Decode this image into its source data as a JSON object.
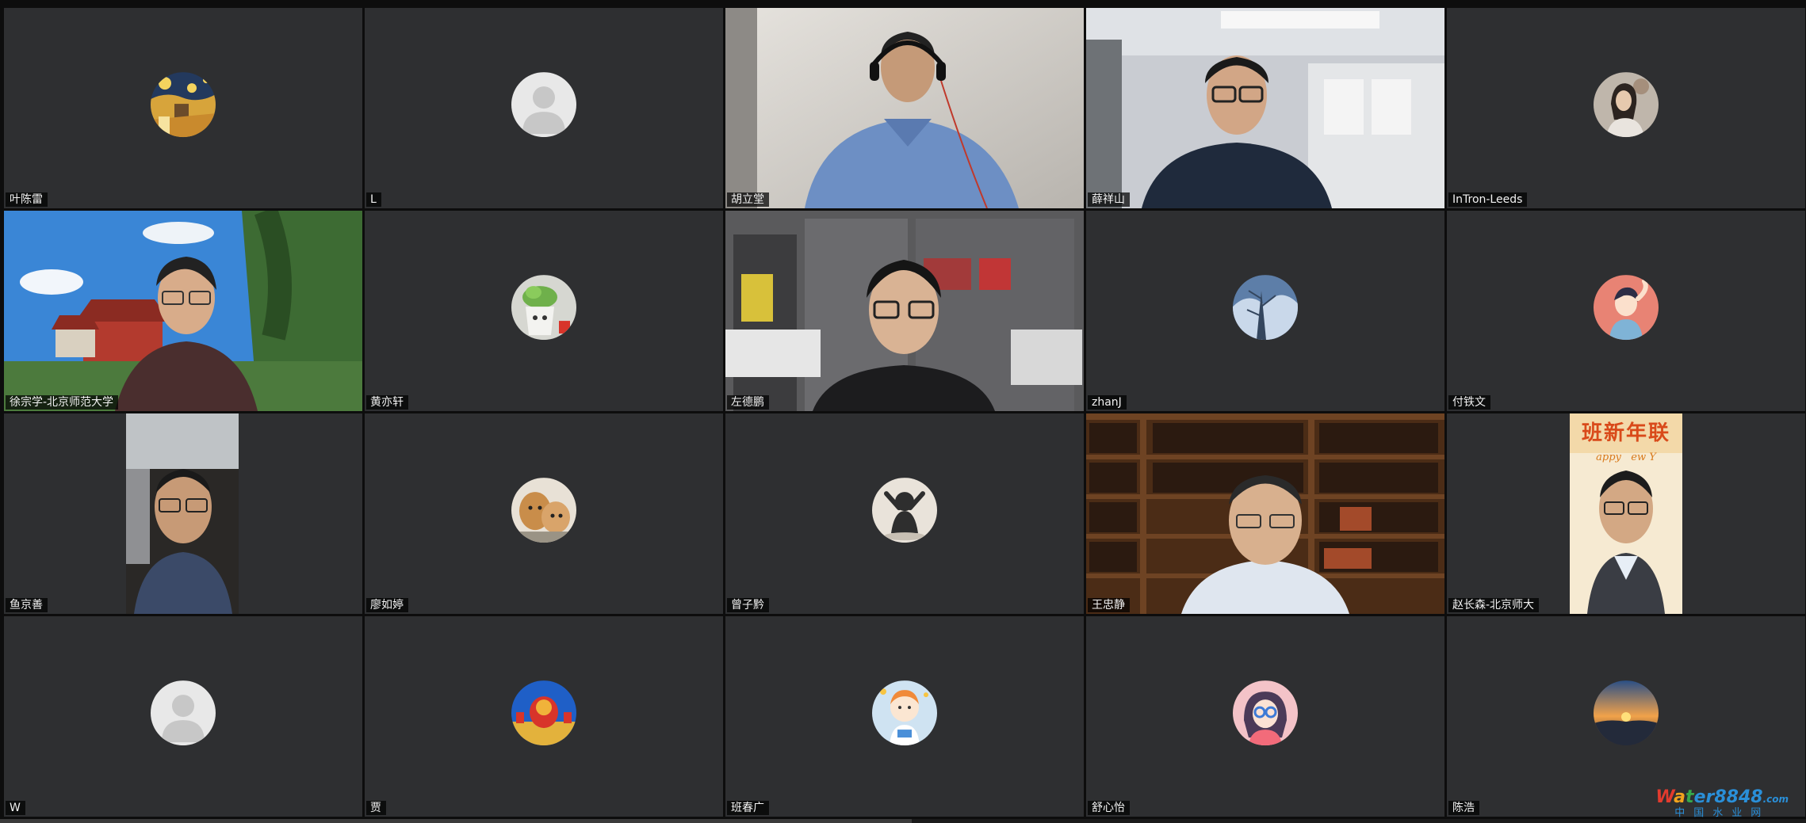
{
  "participants": [
    {
      "name": "叶陈雷",
      "type": "avatar",
      "avatar": "night-painting-avatar-icon"
    },
    {
      "name": "L",
      "type": "avatar",
      "avatar": "default-user-avatar-icon"
    },
    {
      "name": "胡立堂",
      "type": "video"
    },
    {
      "name": "薛祥山",
      "type": "video"
    },
    {
      "name": "InTron-Leeds",
      "type": "avatar",
      "avatar": "portrait-photo-avatar-icon"
    },
    {
      "name": "徐宗学-北京师范大学",
      "type": "video",
      "active_speaker": true
    },
    {
      "name": "黄亦轩",
      "type": "avatar",
      "avatar": "plant-pot-avatar-icon"
    },
    {
      "name": "左德鹏",
      "type": "video"
    },
    {
      "name": "zhanJ",
      "type": "avatar",
      "avatar": "snow-tree-avatar-icon"
    },
    {
      "name": "付铁文",
      "type": "avatar",
      "avatar": "cartoon-boy-avatar-icon"
    },
    {
      "name": "鱼京善",
      "type": "video"
    },
    {
      "name": "廖如婷",
      "type": "avatar",
      "avatar": "puppies-avatar-icon"
    },
    {
      "name": "曾子黔",
      "type": "avatar",
      "avatar": "silhouette-avatar-icon"
    },
    {
      "name": "王忠静",
      "type": "video"
    },
    {
      "name": "赵长森-北京师大",
      "type": "video"
    },
    {
      "name": "W",
      "type": "avatar",
      "avatar": "default-user-avatar-icon"
    },
    {
      "name": "贾",
      "type": "avatar",
      "avatar": "tiananmen-avatar-icon"
    },
    {
      "name": "班春广",
      "type": "avatar",
      "avatar": "cartoon-astronaut-avatar-icon"
    },
    {
      "name": "舒心怡",
      "type": "avatar",
      "avatar": "cartoon-girl-avatar-icon"
    },
    {
      "name": "陈浩",
      "type": "avatar",
      "avatar": "sunset-avatar-icon"
    }
  ],
  "backdrop_text": {
    "banner": "班新年联",
    "banner_sub": "appy   ew Y"
  },
  "watermark": {
    "top_w": "W",
    "top_a": "a",
    "top_t": "t",
    "top_e": "e",
    "top_rest": "r8848",
    "top_suffix": ".com",
    "bottom": "中国水业网"
  },
  "colors": {
    "tile_bg": "#2e2f31",
    "active_border": "#3fc45a",
    "name_tag_bg": "#000000"
  }
}
